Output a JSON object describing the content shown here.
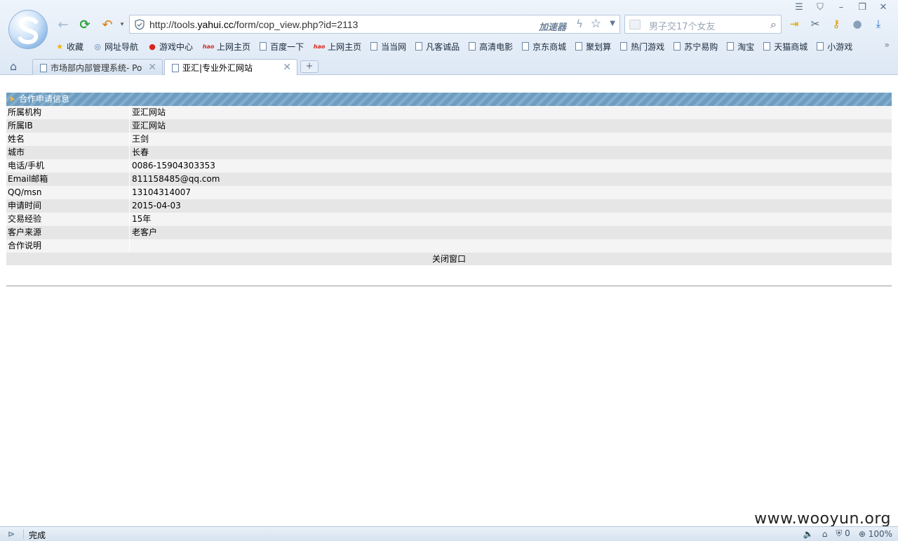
{
  "browser": {
    "url_prefix": "http://tools.",
    "url_domain": "yahui.cc",
    "url_path": "/form/cop_view.php?id=2113",
    "accelerator_label": "加速器",
    "search_placeholder": "男子交17个女友",
    "window_controls": [
      "☰",
      "👕",
      "–",
      "❐",
      "✕"
    ]
  },
  "bookmarks": [
    {
      "label": "收藏",
      "icon": "star-icon"
    },
    {
      "label": "网址导航",
      "icon": "globe-icon"
    },
    {
      "label": "游戏中心",
      "icon": "game-icon"
    },
    {
      "label": "上网主页",
      "icon": "hao-icon"
    },
    {
      "label": "百度一下",
      "icon": "page-icon"
    },
    {
      "label": "上网主页",
      "icon": "hao-icon"
    },
    {
      "label": "当当网",
      "icon": "page-icon"
    },
    {
      "label": "凡客诚品",
      "icon": "page-icon"
    },
    {
      "label": "高清电影",
      "icon": "page-icon"
    },
    {
      "label": "京东商城",
      "icon": "page-icon"
    },
    {
      "label": "聚划算",
      "icon": "page-icon"
    },
    {
      "label": "热门游戏",
      "icon": "page-icon"
    },
    {
      "label": "苏宁易购",
      "icon": "page-icon"
    },
    {
      "label": "淘宝",
      "icon": "page-icon"
    },
    {
      "label": "天猫商城",
      "icon": "page-icon"
    },
    {
      "label": "小游戏",
      "icon": "page-icon"
    }
  ],
  "tabs": [
    {
      "title": "市场部内部管理系统- Po",
      "active": false
    },
    {
      "title": "亚汇|专业外汇网站",
      "active": true
    }
  ],
  "panel": {
    "title": "合作申请信息",
    "rows": [
      {
        "label": "所属机构",
        "value": "亚汇网站"
      },
      {
        "label": "所属IB",
        "value": "亚汇网站"
      },
      {
        "label": "姓名",
        "value": "王剑"
      },
      {
        "label": "城市",
        "value": "长春"
      },
      {
        "label": "电话/手机",
        "value": "0086-15904303353"
      },
      {
        "label": "Email邮箱",
        "value": "811158485@qq.com"
      },
      {
        "label": "QQ/msn",
        "value": "13104314007"
      },
      {
        "label": "申请时间",
        "value": "2015-04-03"
      },
      {
        "label": "交易经验",
        "value": "15年"
      },
      {
        "label": "客户来源",
        "value": "老客户"
      },
      {
        "label": "合作说明",
        "value": ""
      }
    ],
    "close_label": "关闭窗口"
  },
  "status": {
    "text": "完成",
    "shield_count": "0",
    "zoom": "100%"
  },
  "watermark": "www.wooyun.org",
  "colors": {
    "panel_header": "#6e9dbf",
    "row_light": "#f4f4f4",
    "row_dark": "#e6e6e6"
  }
}
